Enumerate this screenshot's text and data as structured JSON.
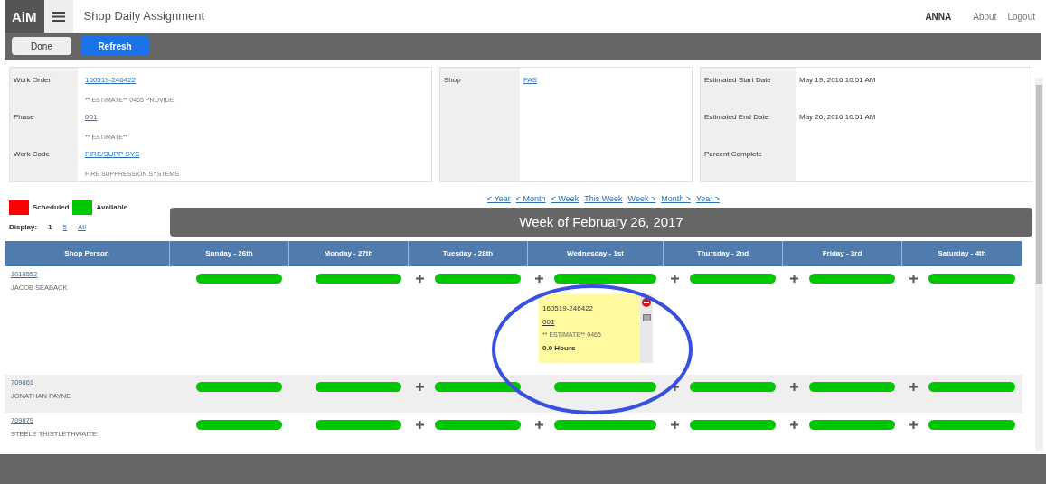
{
  "header": {
    "logo": "AiM",
    "title": "Shop Daily Assignment",
    "user": "ANNA",
    "links": [
      "About",
      "Logout"
    ]
  },
  "toolbar": {
    "buttons": [
      {
        "label": "Done",
        "kind": "plain"
      },
      {
        "label": "Refresh",
        "kind": "primary"
      }
    ]
  },
  "info": {
    "work": [
      {
        "label": "Work Order",
        "link": "160519-246422",
        "note": "** ESTIMATE** 0465 PROVIDE"
      },
      {
        "label": "Phase",
        "link": "001",
        "note": "** ESTIMATE**"
      },
      {
        "label": "Work Code",
        "link": "FIRE/SUPP SYS",
        "note": "FIRE SUPPRESSION SYSTEMS"
      }
    ],
    "shop": {
      "label": "Shop",
      "link": "FAS"
    },
    "dates": [
      {
        "label": "Estimated Start Date",
        "value": "May 19, 2016 10:51 AM"
      },
      {
        "label": "Estimated End Date",
        "value": "May 26, 2016 10:51 AM"
      },
      {
        "label": "Percent Complete"
      }
    ]
  },
  "legend": [
    {
      "label": "Scheduled",
      "color": "#ff0000"
    },
    {
      "label": "Available",
      "color": "#00c800"
    }
  ],
  "display": {
    "label": "Display:",
    "options": [
      {
        "label": "1",
        "selected": true
      },
      {
        "label": "5",
        "selected": false
      },
      {
        "label": "All",
        "selected": false
      }
    ]
  },
  "nav": [
    "< Year",
    "< Month",
    "< Week",
    "This Week",
    "Week >",
    "Month >",
    "Year >"
  ],
  "week_title": "Week of February 26, 2017",
  "columns": [
    "Shop Person",
    "Sunday - 26th",
    "Monday - 27th",
    "Tuesday - 28th",
    "Wednesday - 1st",
    "Thursday - 2nd",
    "Friday - 3rd",
    "Saturday - 4th"
  ],
  "rows": [
    {
      "id": "1019552",
      "name": "JACOB SEABACK",
      "days": [
        {
          "plus": false
        },
        {
          "plus": false
        },
        {
          "plus": true
        },
        {
          "plus": true,
          "card": {
            "work_order": "160519-246422",
            "phase": "001",
            "note": "** ESTIMATE** 0465",
            "hours": "0.0 Hours"
          }
        },
        {
          "plus": true
        },
        {
          "plus": true
        },
        {
          "plus": true
        }
      ]
    },
    {
      "id": "709861",
      "name": "JONATHAN PAYNE",
      "days": [
        {
          "plus": false
        },
        {
          "plus": false
        },
        {
          "plus": true
        },
        {
          "plus": false
        },
        {
          "plus": true
        },
        {
          "plus": true
        },
        {
          "plus": true
        }
      ]
    },
    {
      "id": "709879",
      "name": "STEELE THISTLETHWAITE",
      "days": [
        {
          "plus": false
        },
        {
          "plus": false
        },
        {
          "plus": true
        },
        {
          "plus": true
        },
        {
          "plus": true
        },
        {
          "plus": true
        },
        {
          "plus": true
        }
      ]
    }
  ]
}
